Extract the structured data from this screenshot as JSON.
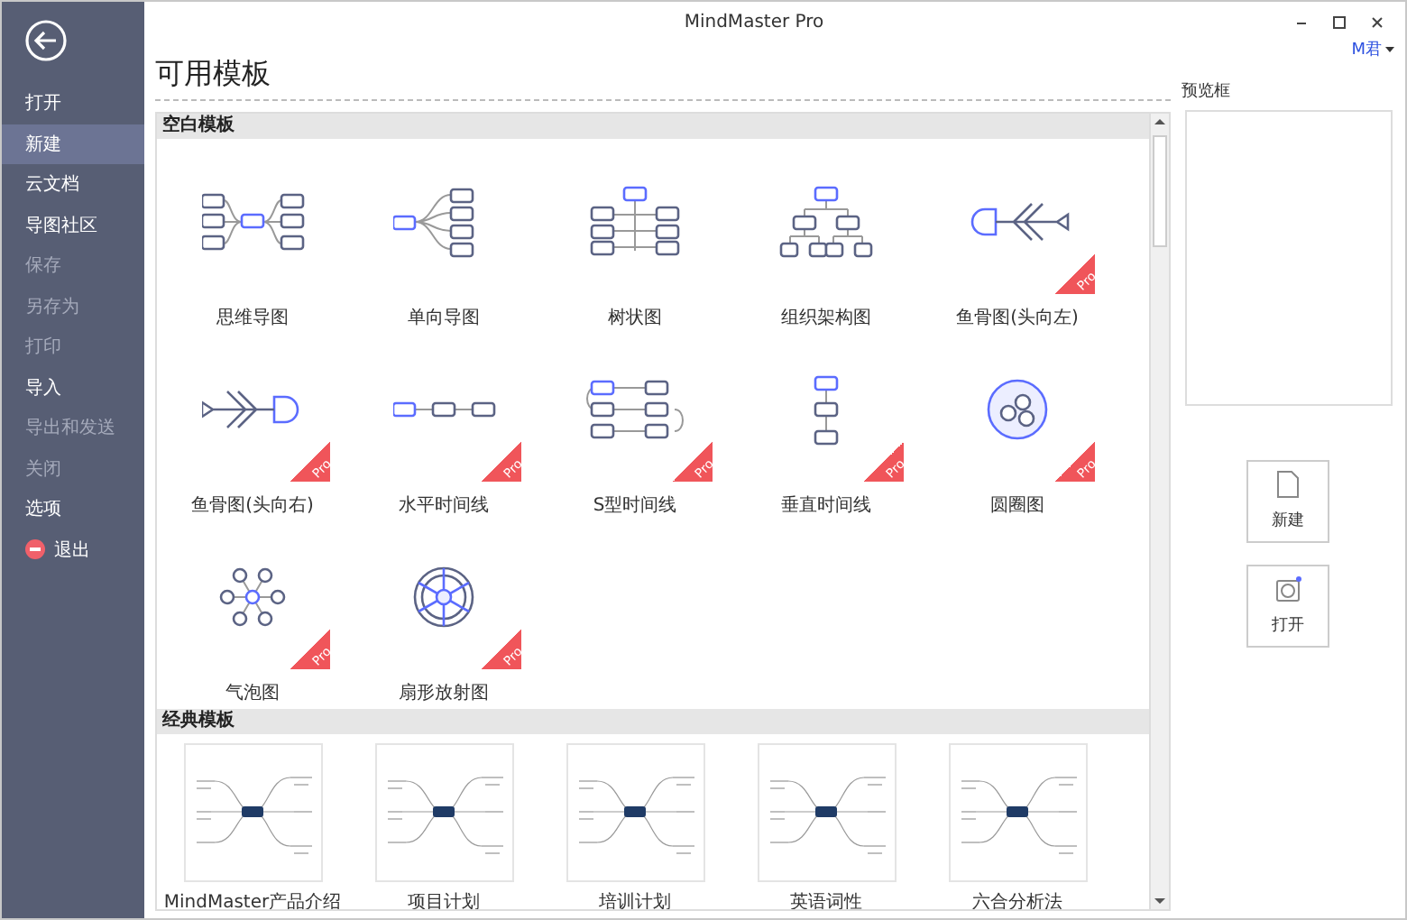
{
  "window": {
    "title": "MindMaster Pro",
    "user": "M君"
  },
  "sidebar": {
    "items": [
      {
        "label": "打开",
        "kind": "normal",
        "selected": false,
        "disabled": false
      },
      {
        "label": "新建",
        "kind": "normal",
        "selected": true,
        "disabled": false
      },
      {
        "label": "云文档",
        "kind": "normal",
        "selected": false,
        "disabled": false
      },
      {
        "label": "导图社区",
        "kind": "normal",
        "selected": false,
        "disabled": false
      },
      {
        "label": "保存",
        "kind": "normal",
        "selected": false,
        "disabled": true
      },
      {
        "label": "另存为",
        "kind": "normal",
        "selected": false,
        "disabled": true
      },
      {
        "label": "打印",
        "kind": "normal",
        "selected": false,
        "disabled": true
      },
      {
        "label": "导入",
        "kind": "normal",
        "selected": false,
        "disabled": false
      },
      {
        "label": "导出和发送",
        "kind": "normal",
        "selected": false,
        "disabled": true
      },
      {
        "label": "关闭",
        "kind": "normal",
        "selected": false,
        "disabled": true
      },
      {
        "label": "选项",
        "kind": "normal",
        "selected": false,
        "disabled": false
      },
      {
        "label": "退出",
        "kind": "exit",
        "selected": false,
        "disabled": false
      }
    ]
  },
  "heading": "可用模板",
  "blank_section": {
    "title": "空白模板",
    "templates": [
      {
        "label": "思维导图",
        "kind": "mindmap"
      },
      {
        "label": "单向导图",
        "kind": "rightmap"
      },
      {
        "label": "树状图",
        "kind": "tree"
      },
      {
        "label": "组织架构图",
        "kind": "org"
      },
      {
        "label": "鱼骨图(头向左)",
        "kind": "fishleft",
        "badge": "Pro"
      },
      {
        "label": "鱼骨图(头向右)",
        "kind": "fishright",
        "badge": "Pro"
      },
      {
        "label": "水平时间线",
        "kind": "htimeline",
        "badge": "Pro"
      },
      {
        "label": "S型时间线",
        "kind": "stimeline",
        "badge": "Pro"
      },
      {
        "label": "垂直时间线",
        "kind": "vtimeline",
        "badge": "Pro"
      },
      {
        "label": "圆圈图",
        "kind": "circle",
        "badge": "Pro"
      },
      {
        "label": "气泡图",
        "kind": "bubble",
        "badge": "Pro"
      },
      {
        "label": "扇形放射图",
        "kind": "radial",
        "badge": "Pro"
      }
    ]
  },
  "classic_section": {
    "title": "经典模板",
    "templates": [
      {
        "label": "MindMaster产品介绍"
      },
      {
        "label": "项目计划"
      },
      {
        "label": "培训计划"
      },
      {
        "label": "英语词性"
      },
      {
        "label": "六合分析法"
      }
    ]
  },
  "preview": {
    "title": "预览框"
  },
  "actions": [
    {
      "label": "新建",
      "kind": "new"
    },
    {
      "label": "打开",
      "kind": "open"
    }
  ]
}
